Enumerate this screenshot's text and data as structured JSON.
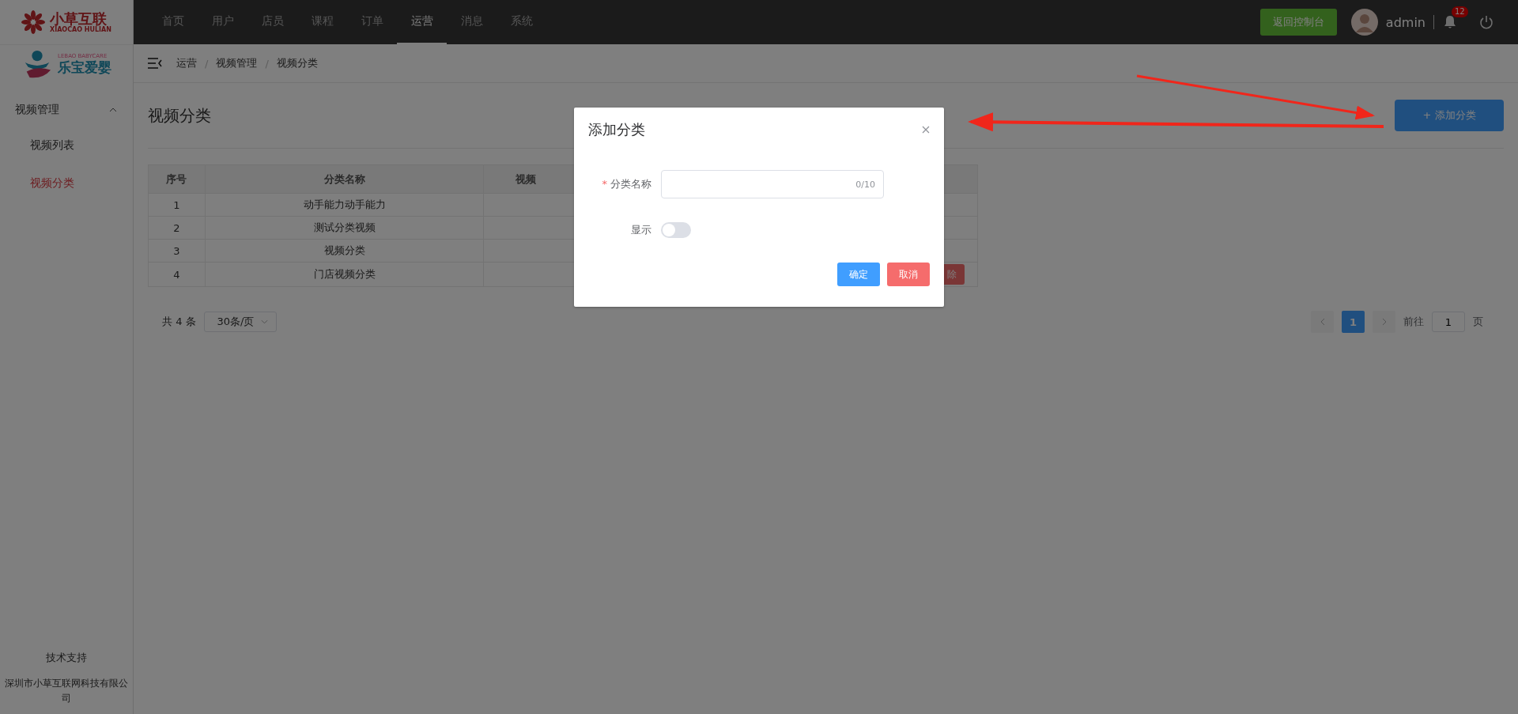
{
  "logos": {
    "brand_name": "小草互联",
    "brand_sub": "XIAOCAO HULIAN",
    "partner_sub": "LEBAO BABYCARE",
    "partner_name": "乐宝爱婴"
  },
  "nav": {
    "items": [
      {
        "label": "首页",
        "selected": false
      },
      {
        "label": "用户",
        "selected": false
      },
      {
        "label": "店员",
        "selected": false
      },
      {
        "label": "课程",
        "selected": false
      },
      {
        "label": "订单",
        "selected": false
      },
      {
        "label": "运营",
        "selected": true
      },
      {
        "label": "消息",
        "selected": false
      },
      {
        "label": "系统",
        "selected": false
      }
    ]
  },
  "header": {
    "console_button": "返回控制台",
    "user": "admin",
    "notification_count": "12"
  },
  "sidebar": {
    "groups": [
      {
        "label": "视频管理",
        "expanded": true,
        "children": [
          {
            "label": "视频列表",
            "selected": false
          },
          {
            "label": "视频分类",
            "selected": true
          }
        ]
      }
    ],
    "footer_title": "技术支持",
    "footer_company": "深圳市小草互联网科技有限公司"
  },
  "breadcrumb": [
    {
      "label": "运营"
    },
    {
      "separator": "/",
      "label": "视频管理"
    },
    {
      "separator": "/",
      "label": "视频分类"
    }
  ],
  "page": {
    "title": "视频分类",
    "add_button": "+ 添加分类"
  },
  "table": {
    "columns": [
      "序号",
      "分类名称",
      "视频"
    ],
    "rows": [
      {
        "index": "1",
        "name": "动手能力动手能力"
      },
      {
        "index": "2",
        "name": "测试分类视频"
      },
      {
        "index": "3",
        "name": "视频分类"
      },
      {
        "index": "4",
        "name": "门店视频分类",
        "action": "除"
      }
    ]
  },
  "pagination": {
    "total": "共 4 条",
    "page_size": "30条/页",
    "pages": [
      {
        "label": "1",
        "selected": true
      }
    ],
    "goto_label": "前往",
    "goto_value": "1",
    "goto_suffix": "页"
  },
  "dialog": {
    "title": "添加分类",
    "fields": [
      {
        "kind": "text",
        "label": "分类名称",
        "required_mark": "*",
        "counter": "0/10"
      },
      {
        "kind": "switch",
        "label": "显示",
        "on": false
      }
    ],
    "buttons": [
      {
        "label": "确定",
        "kind": "primary"
      },
      {
        "label": "取消",
        "kind": "danger"
      }
    ]
  }
}
